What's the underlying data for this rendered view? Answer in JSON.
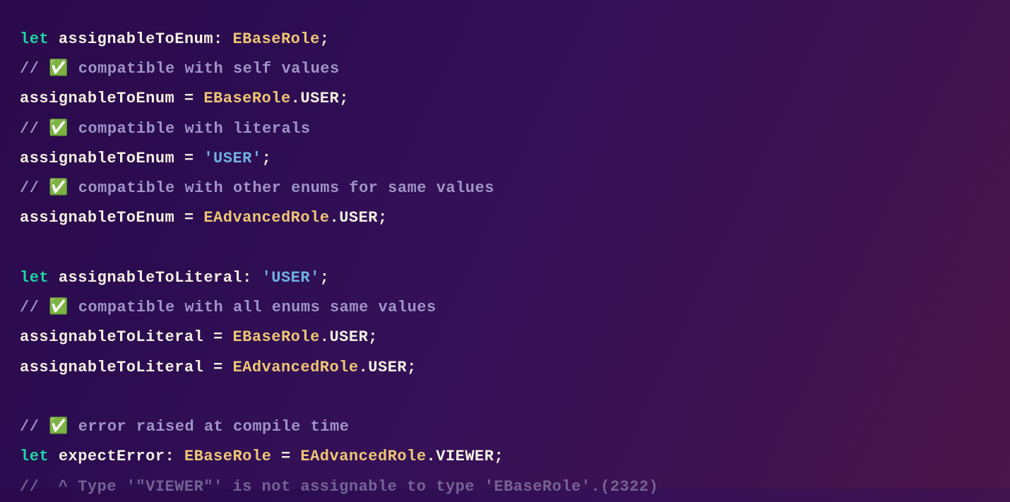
{
  "code": {
    "lines": [
      {
        "type": "code",
        "tokens": [
          {
            "cls": "kw",
            "t": "let"
          },
          {
            "cls": "punct",
            "t": " "
          },
          {
            "cls": "ident",
            "t": "assignableToEnum"
          },
          {
            "cls": "punct",
            "t": ": "
          },
          {
            "cls": "type",
            "t": "EBaseRole"
          },
          {
            "cls": "punct",
            "t": ";"
          }
        ]
      },
      {
        "type": "comment",
        "tokens": [
          {
            "cls": "comment",
            "t": "// "
          },
          {
            "cls": "emoji",
            "t": "✅"
          },
          {
            "cls": "comment",
            "t": " compatible with self values"
          }
        ]
      },
      {
        "type": "code",
        "tokens": [
          {
            "cls": "ident",
            "t": "assignableToEnum"
          },
          {
            "cls": "op",
            "t": " = "
          },
          {
            "cls": "type",
            "t": "EBaseRole"
          },
          {
            "cls": "punct",
            "t": "."
          },
          {
            "cls": "member",
            "t": "USER"
          },
          {
            "cls": "punct",
            "t": ";"
          }
        ]
      },
      {
        "type": "comment",
        "tokens": [
          {
            "cls": "comment",
            "t": "// "
          },
          {
            "cls": "emoji",
            "t": "✅"
          },
          {
            "cls": "comment",
            "t": " compatible with literals"
          }
        ]
      },
      {
        "type": "code",
        "tokens": [
          {
            "cls": "ident",
            "t": "assignableToEnum"
          },
          {
            "cls": "op",
            "t": " = "
          },
          {
            "cls": "string",
            "t": "'USER'"
          },
          {
            "cls": "punct",
            "t": ";"
          }
        ]
      },
      {
        "type": "comment",
        "tokens": [
          {
            "cls": "comment",
            "t": "// "
          },
          {
            "cls": "emoji",
            "t": "✅"
          },
          {
            "cls": "comment",
            "t": " compatible with other enums for same values"
          }
        ]
      },
      {
        "type": "code",
        "tokens": [
          {
            "cls": "ident",
            "t": "assignableToEnum"
          },
          {
            "cls": "op",
            "t": " = "
          },
          {
            "cls": "type",
            "t": "EAdvancedRole"
          },
          {
            "cls": "punct",
            "t": "."
          },
          {
            "cls": "member",
            "t": "USER"
          },
          {
            "cls": "punct",
            "t": ";"
          }
        ]
      },
      {
        "type": "blank"
      },
      {
        "type": "code",
        "tokens": [
          {
            "cls": "kw",
            "t": "let"
          },
          {
            "cls": "punct",
            "t": " "
          },
          {
            "cls": "ident",
            "t": "assignableToLiteral"
          },
          {
            "cls": "punct",
            "t": ": "
          },
          {
            "cls": "string",
            "t": "'USER'"
          },
          {
            "cls": "punct",
            "t": ";"
          }
        ]
      },
      {
        "type": "comment",
        "tokens": [
          {
            "cls": "comment",
            "t": "// "
          },
          {
            "cls": "emoji",
            "t": "✅"
          },
          {
            "cls": "comment",
            "t": " compatible with all enums same values"
          }
        ]
      },
      {
        "type": "code",
        "tokens": [
          {
            "cls": "ident",
            "t": "assignableToLiteral"
          },
          {
            "cls": "op",
            "t": " = "
          },
          {
            "cls": "type",
            "t": "EBaseRole"
          },
          {
            "cls": "punct",
            "t": "."
          },
          {
            "cls": "member",
            "t": "USER"
          },
          {
            "cls": "punct",
            "t": ";"
          }
        ]
      },
      {
        "type": "code",
        "tokens": [
          {
            "cls": "ident",
            "t": "assignableToLiteral"
          },
          {
            "cls": "op",
            "t": " = "
          },
          {
            "cls": "type",
            "t": "EAdvancedRole"
          },
          {
            "cls": "punct",
            "t": "."
          },
          {
            "cls": "member",
            "t": "USER"
          },
          {
            "cls": "punct",
            "t": ";"
          }
        ]
      },
      {
        "type": "blank"
      },
      {
        "type": "comment",
        "tokens": [
          {
            "cls": "comment",
            "t": "// "
          },
          {
            "cls": "emoji",
            "t": "✅"
          },
          {
            "cls": "comment",
            "t": " error raised at compile time"
          }
        ]
      },
      {
        "type": "code",
        "tokens": [
          {
            "cls": "kw",
            "t": "let"
          },
          {
            "cls": "punct",
            "t": " "
          },
          {
            "cls": "ident",
            "t": "expectError"
          },
          {
            "cls": "punct",
            "t": ": "
          },
          {
            "cls": "type",
            "t": "EBaseRole"
          },
          {
            "cls": "op",
            "t": " = "
          },
          {
            "cls": "type",
            "t": "EAdvancedRole"
          },
          {
            "cls": "punct",
            "t": "."
          },
          {
            "cls": "member",
            "t": "VIEWER"
          },
          {
            "cls": "punct",
            "t": ";"
          }
        ]
      },
      {
        "type": "comment",
        "tokens": [
          {
            "cls": "dim",
            "t": "//  ^ Type '\"VIEWER\"' is not assignable to type 'EBaseRole'.(2322)"
          }
        ]
      }
    ]
  }
}
